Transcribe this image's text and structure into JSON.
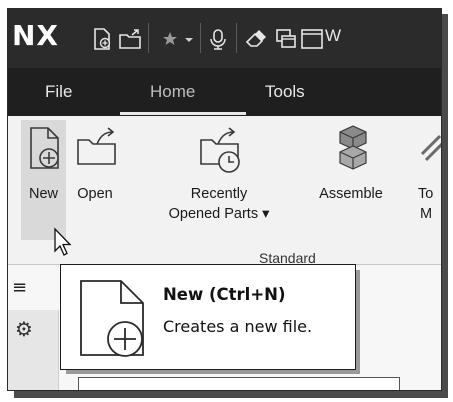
{
  "app": {
    "logo": "NX"
  },
  "title_overflow_char": "W",
  "menu": {
    "items": [
      "File",
      "Home",
      "Tools"
    ],
    "active": "Home"
  },
  "ribbon": {
    "buttons": [
      {
        "id": "new",
        "label": "New"
      },
      {
        "id": "open",
        "label": "Open"
      },
      {
        "id": "recent",
        "label_line1": "Recently",
        "label_line2": "Opened Parts ▾"
      },
      {
        "id": "assemble",
        "label": "Assemble"
      },
      {
        "id": "cut",
        "label_line1": "To",
        "label_line2": "M"
      }
    ],
    "group_label": "Standard"
  },
  "tooltip": {
    "title": "New (Ctrl+N)",
    "description": "Creates a new file."
  },
  "colors": {
    "titlebar": "#2b2b2b",
    "menubar": "#1f1f1f",
    "ribbon": "#f2f2f2",
    "pressed": "#d9d9d9"
  }
}
